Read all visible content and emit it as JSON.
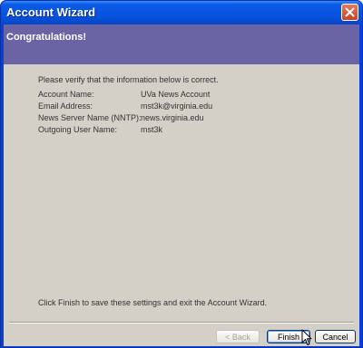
{
  "window": {
    "title": "Account Wizard"
  },
  "header": {
    "title": "Congratulations!"
  },
  "content": {
    "intro": "Please verify that the information below is correct.",
    "info": [
      {
        "label": "Account Name:",
        "value": "UVa News Account"
      },
      {
        "label": "Email Address:",
        "value": "mst3k@virginia.edu"
      },
      {
        "label": "News Server Name (NNTP):",
        "value": "news.virginia.edu"
      },
      {
        "label": "Outgoing User Name:",
        "value": "mst3k"
      }
    ],
    "finish_text": "Click Finish to save these settings and exit the Account Wizard."
  },
  "buttons": {
    "back": "< Back",
    "finish": "Finish",
    "cancel": "Cancel"
  }
}
